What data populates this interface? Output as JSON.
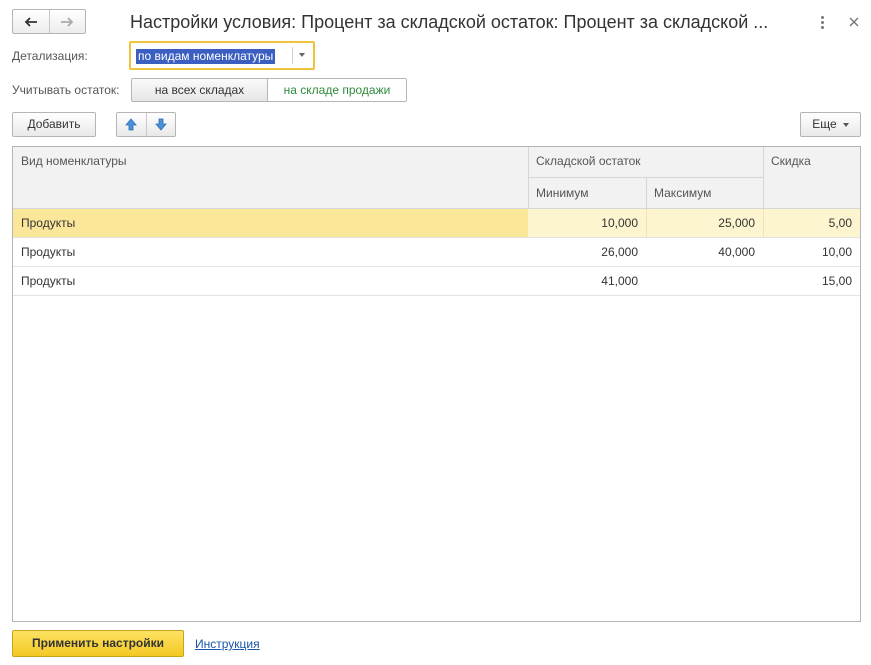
{
  "window": {
    "title": "Настройки условия: Процент за складской остаток: Процент за складской ..."
  },
  "icons": {
    "back": "arrow-left-icon",
    "forward": "arrow-right-icon",
    "more": "more-vertical-icon",
    "close": "close-icon",
    "up": "arrow-up-icon",
    "down": "arrow-down-icon"
  },
  "form": {
    "detail_label": "Детализация:",
    "detail_value": "по видам номенклатуры",
    "stock_label": "Учитывать остаток:",
    "stock_options": [
      "на всех складах",
      "на складе продажи"
    ],
    "stock_selected": "на складе продажи"
  },
  "toolbar": {
    "add_label": "Добавить",
    "more_label": "Еще"
  },
  "table": {
    "col_name": "Вид номенклатуры",
    "col_stock_group": "Складской остаток",
    "col_min": "Минимум",
    "col_max": "Максимум",
    "col_discount": "Скидка",
    "rows": [
      {
        "name": "Продукты",
        "min": "10,000",
        "max": "25,000",
        "discount": "5,00"
      },
      {
        "name": "Продукты",
        "min": "26,000",
        "max": "40,000",
        "discount": "10,00"
      },
      {
        "name": "Продукты",
        "min": "41,000",
        "max": "",
        "discount": "15,00"
      }
    ]
  },
  "footer": {
    "apply_label": "Применить настройки",
    "help_label": "Инструкция"
  },
  "colors": {
    "accent_yellow": "#f3c823",
    "selected_row": "#fbe79a",
    "selection_highlight": "#3a5fc1",
    "active_option": "#2f8a3b",
    "link": "#1a55a6"
  }
}
